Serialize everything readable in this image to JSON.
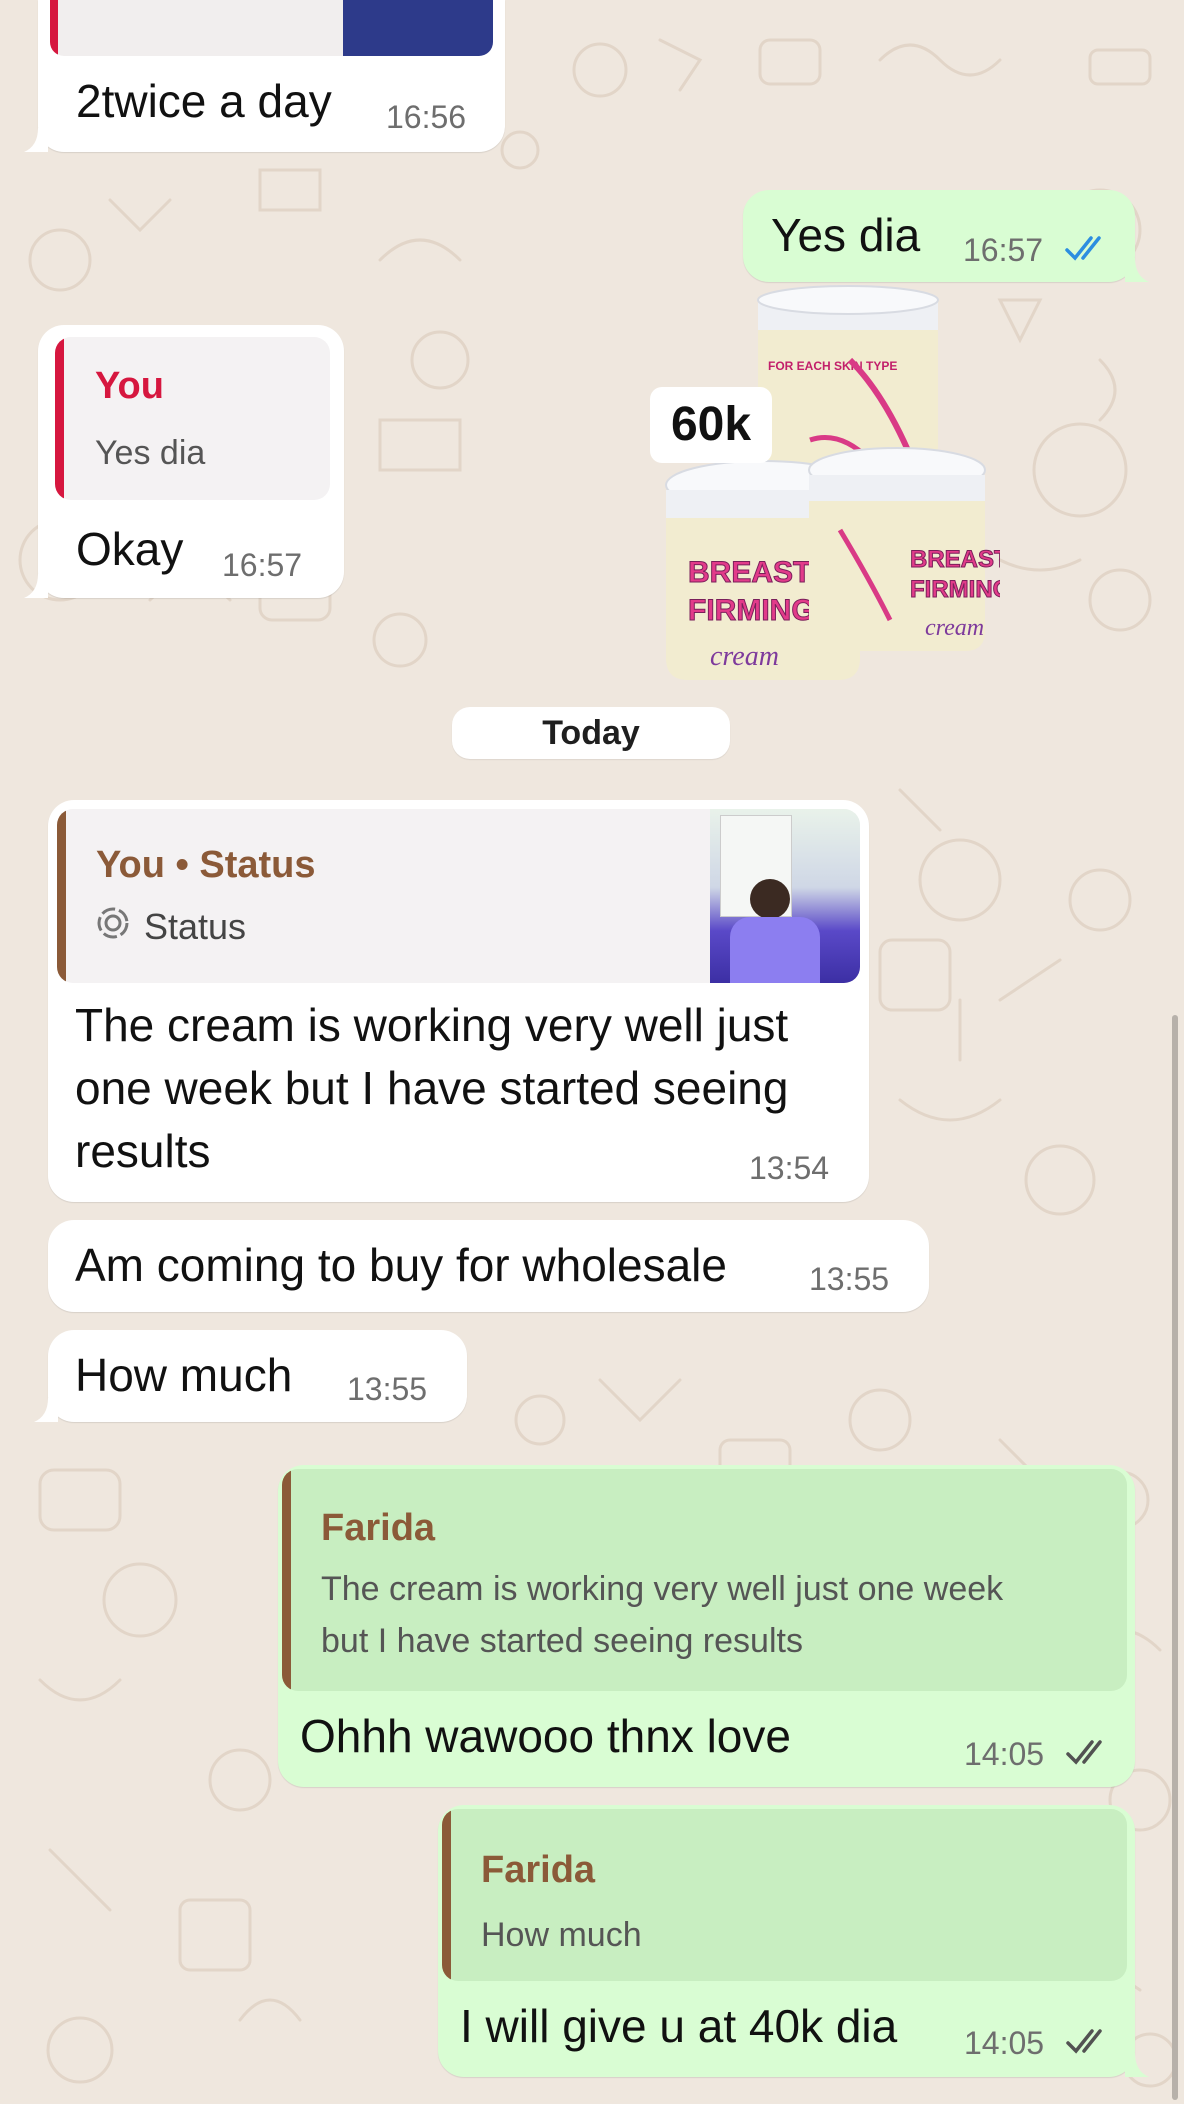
{
  "chat": {
    "day_separator": "Today",
    "messages": [
      {
        "id": "m1",
        "direction": "incoming",
        "text": "2twice a day",
        "time": "16:56"
      },
      {
        "id": "m2",
        "direction": "outgoing",
        "text": "Yes dia",
        "time": "16:57",
        "status": "read"
      },
      {
        "id": "m3",
        "direction": "incoming",
        "reply_to": {
          "author": "You",
          "text": "Yes dia"
        },
        "text": "Okay",
        "time": "16:57"
      },
      {
        "id": "m4",
        "direction": "outgoing",
        "type": "sticker",
        "sticker_price_label": "60k",
        "sticker_jar_text": [
          "BREAST",
          "FIRMING",
          "cream"
        ],
        "sticker_label_header": "FOR EACH SKIN TYPE"
      },
      {
        "id": "m5",
        "direction": "incoming",
        "reply_to": {
          "author": "You • Status",
          "text": "Status"
        },
        "text_lines": [
          "The cream is working very well just",
          "one week but I have started seeing",
          "results"
        ],
        "time": "13:54"
      },
      {
        "id": "m6",
        "direction": "incoming",
        "text": "Am coming to buy for wholesale",
        "time": "13:55"
      },
      {
        "id": "m7",
        "direction": "incoming",
        "text": "How much",
        "time": "13:55"
      },
      {
        "id": "m8",
        "direction": "outgoing",
        "reply_to": {
          "author": "Farida",
          "text_lines": [
            "The cream is working very well just one week",
            "but I have started seeing results"
          ]
        },
        "text": "Ohhh wawooo thnx love",
        "time": "14:05",
        "status": "delivered"
      },
      {
        "id": "m9",
        "direction": "outgoing",
        "reply_to": {
          "author": "Farida",
          "text": "How much"
        },
        "text": "I will give u at 40k dia",
        "time": "14:05",
        "status": "delivered"
      }
    ]
  },
  "colors": {
    "wallpaper": "#efe7de",
    "incoming_bubble": "#ffffff",
    "outgoing_bubble": "#d9fdd3",
    "reply_you_accent": "#d6173f",
    "reply_status_accent": "#8b5a38",
    "read_ticks": "#2c8ee0",
    "delivered_ticks": "#525252"
  },
  "icons": {
    "read_receipt": "double-check-icon",
    "status_ring": "status-ring-icon"
  }
}
